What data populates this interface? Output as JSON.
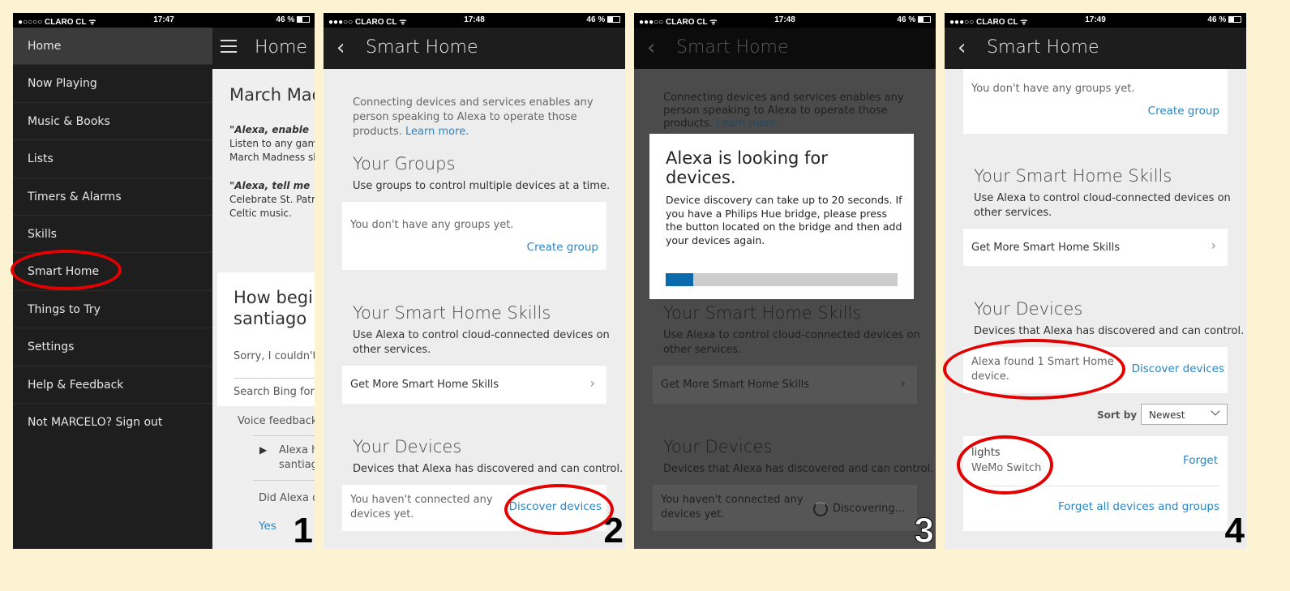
{
  "panels": [
    {
      "status": {
        "carrier": "●○○○○ CLARO CL ᯤ",
        "time": "17:47",
        "battery": "46 %"
      },
      "drawer_items": [
        "Home",
        "Now Playing",
        "Music & Books",
        "Lists",
        "Timers & Alarms",
        "Skills",
        "Smart Home",
        "Things to Try",
        "Settings",
        "Help & Feedback",
        "Not MARCELO? Sign out"
      ],
      "header_title": "Home",
      "content": {
        "card_title": "March Mad",
        "q1": "\"Alexa, enable",
        "q1_text": "Listen to any gam\nMarch Madness sk",
        "q2": "\"Alexa, tell me",
        "q2_text": "Celebrate St. Patri\nCeltic music.",
        "card2_title": "How begi\nsantiago",
        "sorry": "Sorry, I couldn't",
        "search_bing": "Search Bing for",
        "voice_feedback": "Voice feedback",
        "alexa_heard": "Alexa h\nsantiag",
        "did_alexa": "Did Alexa d",
        "yes": "Yes"
      },
      "number": "1"
    },
    {
      "status": {
        "carrier": "●●●○○ CLARO CL ᯤ",
        "time": "17:48",
        "battery": "46 %"
      },
      "header_title": "Smart Home",
      "intro": "Connecting devices and services enables any person speaking to Alexa to operate those products.",
      "learn_more": "Learn more.",
      "groups_title": "Your Groups",
      "groups_sub": "Use groups to control multiple devices at a time.",
      "no_groups": "You don't have any groups yet.",
      "create_group": "Create group",
      "skills_title": "Your Smart Home Skills",
      "skills_sub": "Use Alexa to control cloud-connected devices on other services.",
      "get_skills": "Get More Smart Home Skills",
      "devices_title": "Your Devices",
      "devices_sub": "Devices that Alexa has discovered and can control.",
      "no_devices": "You haven't connected any devices yet.",
      "discover": "Discover devices",
      "number": "2"
    },
    {
      "status": {
        "carrier": "●●●○○ CLARO CL ᯤ",
        "time": "17:48",
        "battery": "46 %"
      },
      "header_title": "Smart Home",
      "intro": "Connecting devices and services enables any person speaking to Alexa to operate those products.",
      "learn_more": "Learn more.",
      "skills_title": "Your Smart Home Skills",
      "skills_sub": "Use Alexa to control cloud-connected devices on other services.",
      "get_skills": "Get More Smart Home Skills",
      "devices_title": "Your Devices",
      "devices_sub": "Devices that Alexa has discovered and can control.",
      "no_devices": "You haven't connected any devices yet.",
      "discovering": "Discovering...",
      "dialog": {
        "title": "Alexa is looking for devices.",
        "body": "Device discovery can take up to 20 seconds. If you have a Philips Hue bridge, please press the button located on the bridge and then add your devices again.",
        "progress_percent": 12
      },
      "number": "3"
    },
    {
      "status": {
        "carrier": "●●●○○ CLARO CL ᯤ",
        "time": "17:49",
        "battery": "46 %"
      },
      "header_title": "Smart Home",
      "no_groups": "You don't have any groups yet.",
      "create_group": "Create group",
      "skills_title": "Your Smart Home Skills",
      "skills_sub": "Use Alexa to control cloud-connected devices on other services.",
      "get_skills": "Get More Smart Home Skills",
      "devices_title": "Your Devices",
      "devices_sub": "Devices that Alexa has discovered and can control.",
      "found": "Alexa found 1 Smart Home device.",
      "discover": "Discover devices",
      "sort_label": "Sort by",
      "sort_value": "Newest",
      "device_name": "lights",
      "device_type": "WeMo Switch",
      "forget": "Forget",
      "forget_all": "Forget all devices and groups",
      "number": "4"
    }
  ],
  "colors": {
    "link": "#2a85c3",
    "highlight": "#e30000",
    "progress": "#0b6aac",
    "background": "#fdf3d3"
  }
}
